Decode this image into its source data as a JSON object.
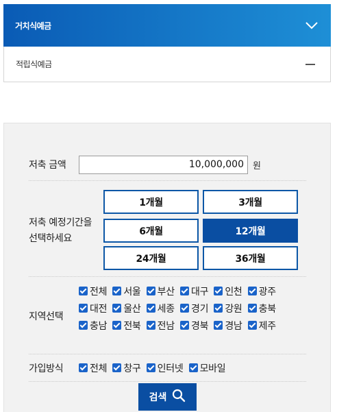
{
  "tabs": [
    {
      "label": "거치식예금",
      "state": "expanded",
      "icon": "chevron-down-icon"
    },
    {
      "label": "적립식예금",
      "state": "collapsed",
      "icon": "minus-icon"
    }
  ],
  "form": {
    "amount": {
      "label": "저축 금액",
      "value": "10,000,000",
      "unit": "원"
    },
    "period": {
      "label_line1": "저축 예정기간을",
      "label_line2": "선택하세요",
      "options": [
        "1개월",
        "3개월",
        "6개월",
        "12개월",
        "24개월",
        "36개월"
      ],
      "selected": "12개월"
    },
    "region": {
      "label": "지역선택",
      "options": [
        "전체",
        "서울",
        "부산",
        "대구",
        "인천",
        "광주",
        "대전",
        "울산",
        "세종",
        "경기",
        "강원",
        "충북",
        "충남",
        "전북",
        "전남",
        "경북",
        "경남",
        "제주"
      ],
      "checked": "all"
    },
    "method": {
      "label": "가입방식",
      "options": [
        "전체",
        "창구",
        "인터넷",
        "모바일"
      ],
      "checked": "all"
    },
    "search_label": "검색"
  },
  "colors": {
    "accent": "#0a4ea2",
    "tab_gradient_start": "#0a5bb5",
    "tab_gradient_end": "#1e8fd6",
    "checkbox": "#1a63c9"
  }
}
